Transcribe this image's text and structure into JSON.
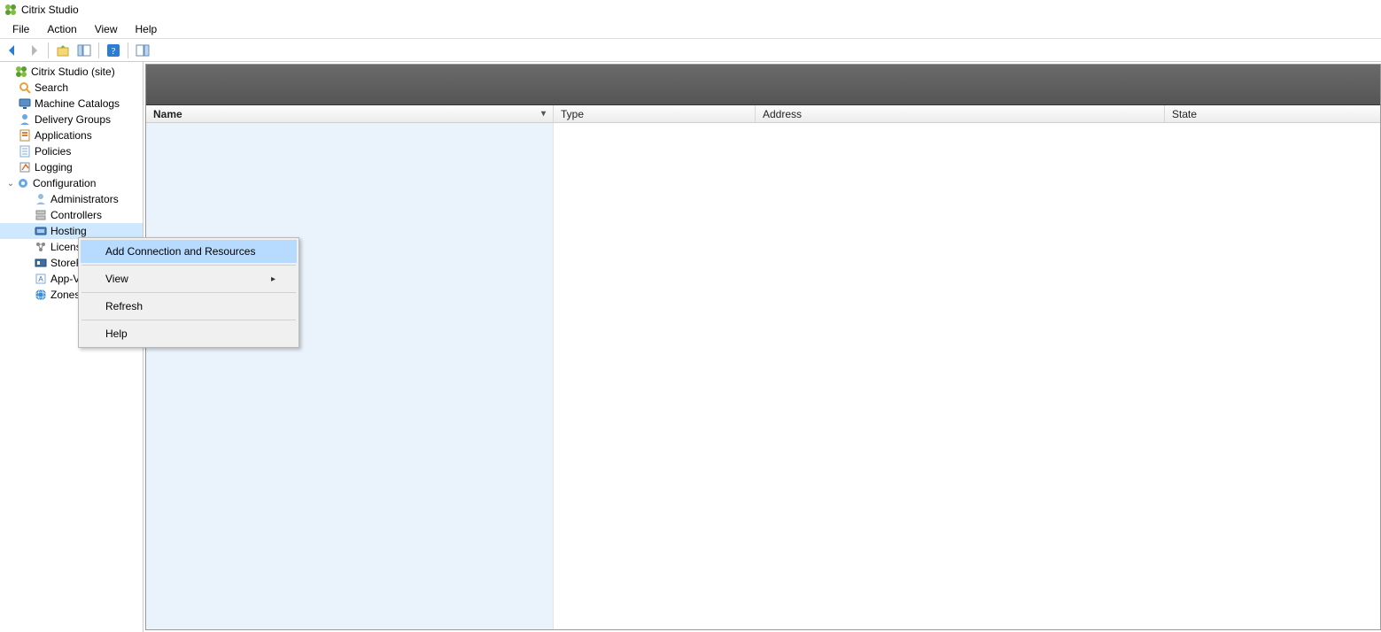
{
  "app": {
    "title": "Citrix Studio"
  },
  "menu": {
    "file": "File",
    "action": "Action",
    "view": "View",
    "help": "Help"
  },
  "tree": {
    "root": "Citrix Studio (site)",
    "items": [
      "Search",
      "Machine Catalogs",
      "Delivery Groups",
      "Applications",
      "Policies",
      "Logging"
    ],
    "config_label": "Configuration",
    "config_items": [
      "Administrators",
      "Controllers",
      "Hosting",
      "Licensing",
      "StoreFront",
      "App-V Publishing",
      "Zones"
    ]
  },
  "columns": {
    "name": "Name",
    "type": "Type",
    "address": "Address",
    "state": "State"
  },
  "context_menu": {
    "add": "Add Connection and Resources",
    "view": "View",
    "refresh": "Refresh",
    "help": "Help"
  }
}
